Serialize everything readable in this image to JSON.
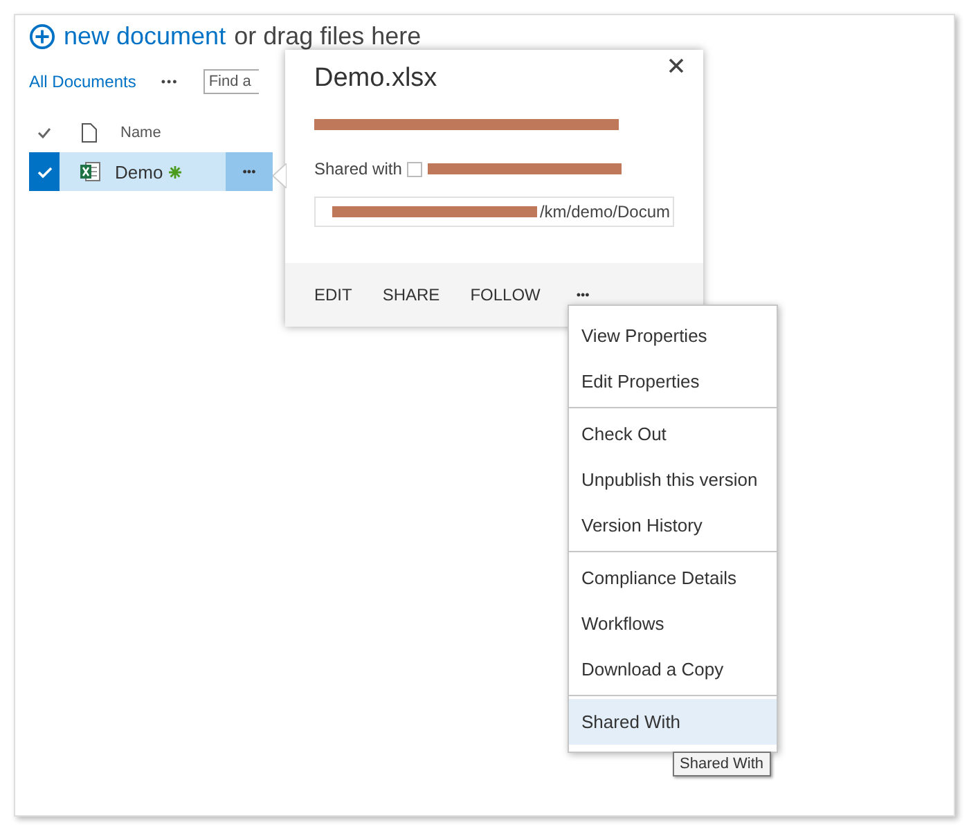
{
  "header": {
    "new_document": "new document",
    "drop_hint": "or drag files here"
  },
  "toolbar": {
    "view": "All Documents",
    "more": "•••",
    "search": {
      "placeholder": "Find a"
    }
  },
  "columns": {
    "name": "Name"
  },
  "rows": [
    {
      "name": "Demo",
      "selected": true,
      "is_new": true,
      "more": "•••"
    }
  ],
  "callout": {
    "title": "Demo.xlsx",
    "shared_with": "Shared with",
    "url": "/km/demo/Docum",
    "actions": [
      "EDIT",
      "SHARE",
      "FOLLOW"
    ],
    "more": "•••"
  },
  "menu": {
    "groups": [
      [
        {
          "label": "View Properties",
          "selected": false
        },
        {
          "label": "Edit Properties",
          "selected": false
        }
      ],
      [
        {
          "label": "Check Out",
          "selected": false
        },
        {
          "label": "Unpublish this version",
          "selected": false
        },
        {
          "label": "Version History",
          "selected": false
        }
      ],
      [
        {
          "label": "Compliance Details",
          "selected": false
        },
        {
          "label": "Workflows",
          "selected": false
        },
        {
          "label": "Download a Copy",
          "selected": false
        }
      ],
      [
        {
          "label": "Shared With",
          "selected": true
        }
      ]
    ]
  },
  "tooltip": "Shared With"
}
